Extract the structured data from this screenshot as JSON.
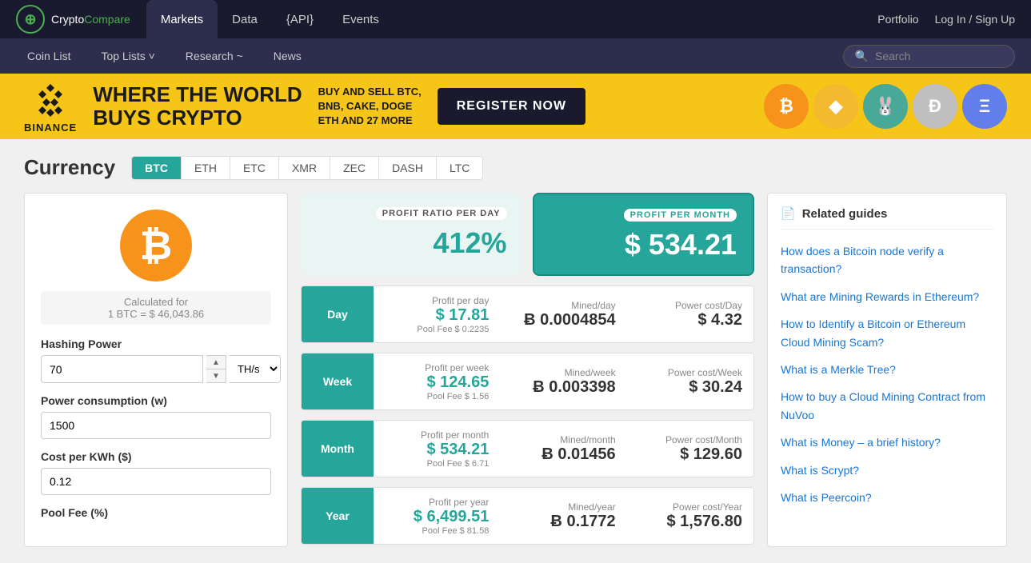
{
  "logo": {
    "crypto": "Crypto",
    "compare": "Compare",
    "icon_char": "⊕"
  },
  "top_nav": {
    "items": [
      {
        "label": "Markets",
        "active": true
      },
      {
        "label": "Data",
        "active": false
      },
      {
        "label": "{API}",
        "active": false
      },
      {
        "label": "Events",
        "active": false
      }
    ],
    "right": [
      {
        "label": "Portfolio"
      },
      {
        "label": "Log In / Sign Up"
      }
    ]
  },
  "sec_nav": {
    "items": [
      {
        "label": "Coin List"
      },
      {
        "label": "Top Lists ˅"
      },
      {
        "label": "Research ~"
      },
      {
        "label": "News"
      }
    ],
    "search_placeholder": "Search"
  },
  "banner": {
    "logo_text": "BINANCE",
    "headline_line1": "WHERE THE WORLD",
    "headline_line2": "BUYS CRYPTO",
    "sub_text": "BUY AND SELL BTC,\nBNB, CAKE, DOGE\nETH AND 27 MORE",
    "cta": "REGISTER NOW"
  },
  "currency": {
    "title": "Currency",
    "tabs": [
      "BTC",
      "ETH",
      "ETC",
      "XMR",
      "ZEC",
      "DASH",
      "LTC"
    ],
    "active_tab": "BTC"
  },
  "calculator": {
    "btc_char": "₿",
    "calc_for_label": "Calculated for",
    "calc_for_value": "1 BTC = $ 46,043.86",
    "hashing_power_label": "Hashing Power",
    "hashing_value": "70",
    "hashing_unit": "TH/s",
    "power_label": "Power consumption (w)",
    "power_value": "1500",
    "cost_label": "Cost per KWh ($)",
    "cost_value": "0.12",
    "pool_fee_label": "Pool Fee (%)"
  },
  "profit_summary": {
    "day_label": "PROFIT RATIO PER DAY",
    "day_value": "412%",
    "month_label": "PROFIT PER MONTH",
    "month_value": "$ 534.21"
  },
  "detail_rows": [
    {
      "period": "Day",
      "profit_label": "Profit per day",
      "profit_value": "$ 17.81",
      "pool_fee": "Pool Fee $ 0.2235",
      "mined_label": "Mined/day",
      "mined_value": "Ƀ 0.0004854",
      "power_label": "Power cost/Day",
      "power_value": "$ 4.32"
    },
    {
      "period": "Week",
      "profit_label": "Profit per week",
      "profit_value": "$ 124.65",
      "pool_fee": "Pool Fee $ 1.56",
      "mined_label": "Mined/week",
      "mined_value": "Ƀ 0.003398",
      "power_label": "Power cost/Week",
      "power_value": "$ 30.24"
    },
    {
      "period": "Month",
      "profit_label": "Profit per month",
      "profit_value": "$ 534.21",
      "pool_fee": "Pool Fee $ 6.71",
      "mined_label": "Mined/month",
      "mined_value": "Ƀ 0.01456",
      "power_label": "Power cost/Month",
      "power_value": "$ 129.60"
    },
    {
      "period": "Year",
      "profit_label": "Profit per year",
      "profit_value": "$ 6,499.51",
      "pool_fee": "Pool Fee $ 81.58",
      "mined_label": "Mined/year",
      "mined_value": "Ƀ 0.1772",
      "power_label": "Power cost/Year",
      "power_value": "$ 1,576.80"
    }
  ],
  "related_guides": {
    "header": "Related guides",
    "links": [
      {
        "text": "How does a Bitcoin node verify a transaction?"
      },
      {
        "text": "What are Mining Rewards in Ethereum?"
      },
      {
        "text": "How to Identify a Bitcoin or Ethereum Cloud Mining Scam?"
      },
      {
        "text": "What is a Merkle Tree?"
      },
      {
        "text": "How to buy a Cloud Mining Contract from NuVoo"
      },
      {
        "text": "What is Money – a brief history?"
      },
      {
        "text": "What is Scrypt?"
      },
      {
        "text": "What is Peercoin?"
      }
    ]
  }
}
